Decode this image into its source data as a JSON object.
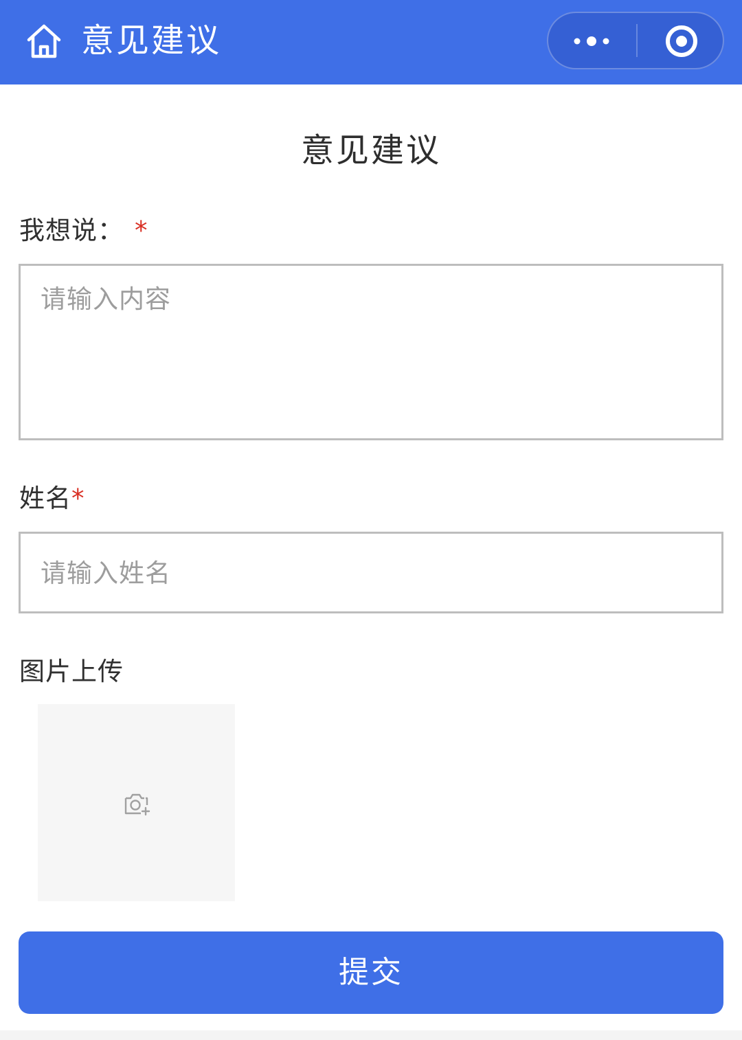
{
  "navbar": {
    "title": "意见建议",
    "home_icon": "home-icon",
    "more_icon": "more-dots-icon",
    "close_icon": "target-close-icon",
    "background_color": "#3f6fe7"
  },
  "page": {
    "title": "意见建议"
  },
  "form": {
    "content": {
      "label": "我想说：",
      "required_mark": "*",
      "placeholder": "请输入内容",
      "value": ""
    },
    "name": {
      "label": "姓名",
      "required_mark": "*",
      "placeholder": "请输入姓名",
      "value": ""
    },
    "upload": {
      "label": "图片上传",
      "icon": "camera-add-icon"
    },
    "submit_label": "提交"
  },
  "colors": {
    "primary": "#3f6fe7",
    "required": "#d93025",
    "placeholder": "#9d9d9d",
    "border": "#bdbdbd"
  }
}
